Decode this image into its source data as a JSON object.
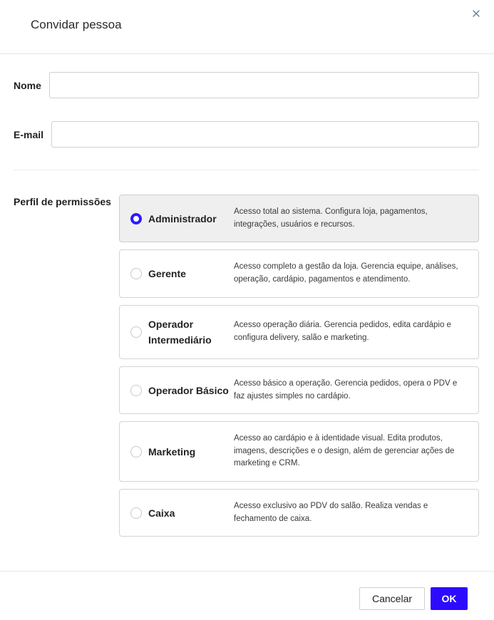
{
  "dialog": {
    "title": "Convidar pessoa"
  },
  "form": {
    "name_label": "Nome",
    "name_value": "",
    "email_label": "E-mail",
    "email_value": "",
    "permissions_label": "Perfil de permissões"
  },
  "roles": [
    {
      "name": "Administrador",
      "description": "Acesso total ao sistema. Configura loja, pagamentos, integrações, usuários e recursos.",
      "selected": true
    },
    {
      "name": "Gerente",
      "description": "Acesso completo a gestão da loja. Gerencia equipe, análises, operação, cardápio, pagamentos e atendimento.",
      "selected": false
    },
    {
      "name": "Operador Intermediário",
      "description": "Acesso operação diária. Gerencia pedidos, edita cardápio e configura delivery, salão e marketing.",
      "selected": false
    },
    {
      "name": "Operador Básico",
      "description": "Acesso básico a operação. Gerencia pedidos, opera o PDV e faz ajustes simples no cardápio.",
      "selected": false
    },
    {
      "name": "Marketing",
      "description": "Acesso ao cardápio e à identidade visual. Edita produtos, imagens, descrições e o design, além de gerenciar ações de marketing e CRM.",
      "selected": false
    },
    {
      "name": "Caixa",
      "description": "Acesso exclusivo ao PDV do salão. Realiza vendas e fechamento de caixa.",
      "selected": false
    }
  ],
  "footer": {
    "cancel_label": "Cancelar",
    "ok_label": "OK"
  },
  "colors": {
    "accent": "#2d0bff",
    "selected_card_bg": "#efefef"
  },
  "icons": {
    "close": "close-icon"
  }
}
